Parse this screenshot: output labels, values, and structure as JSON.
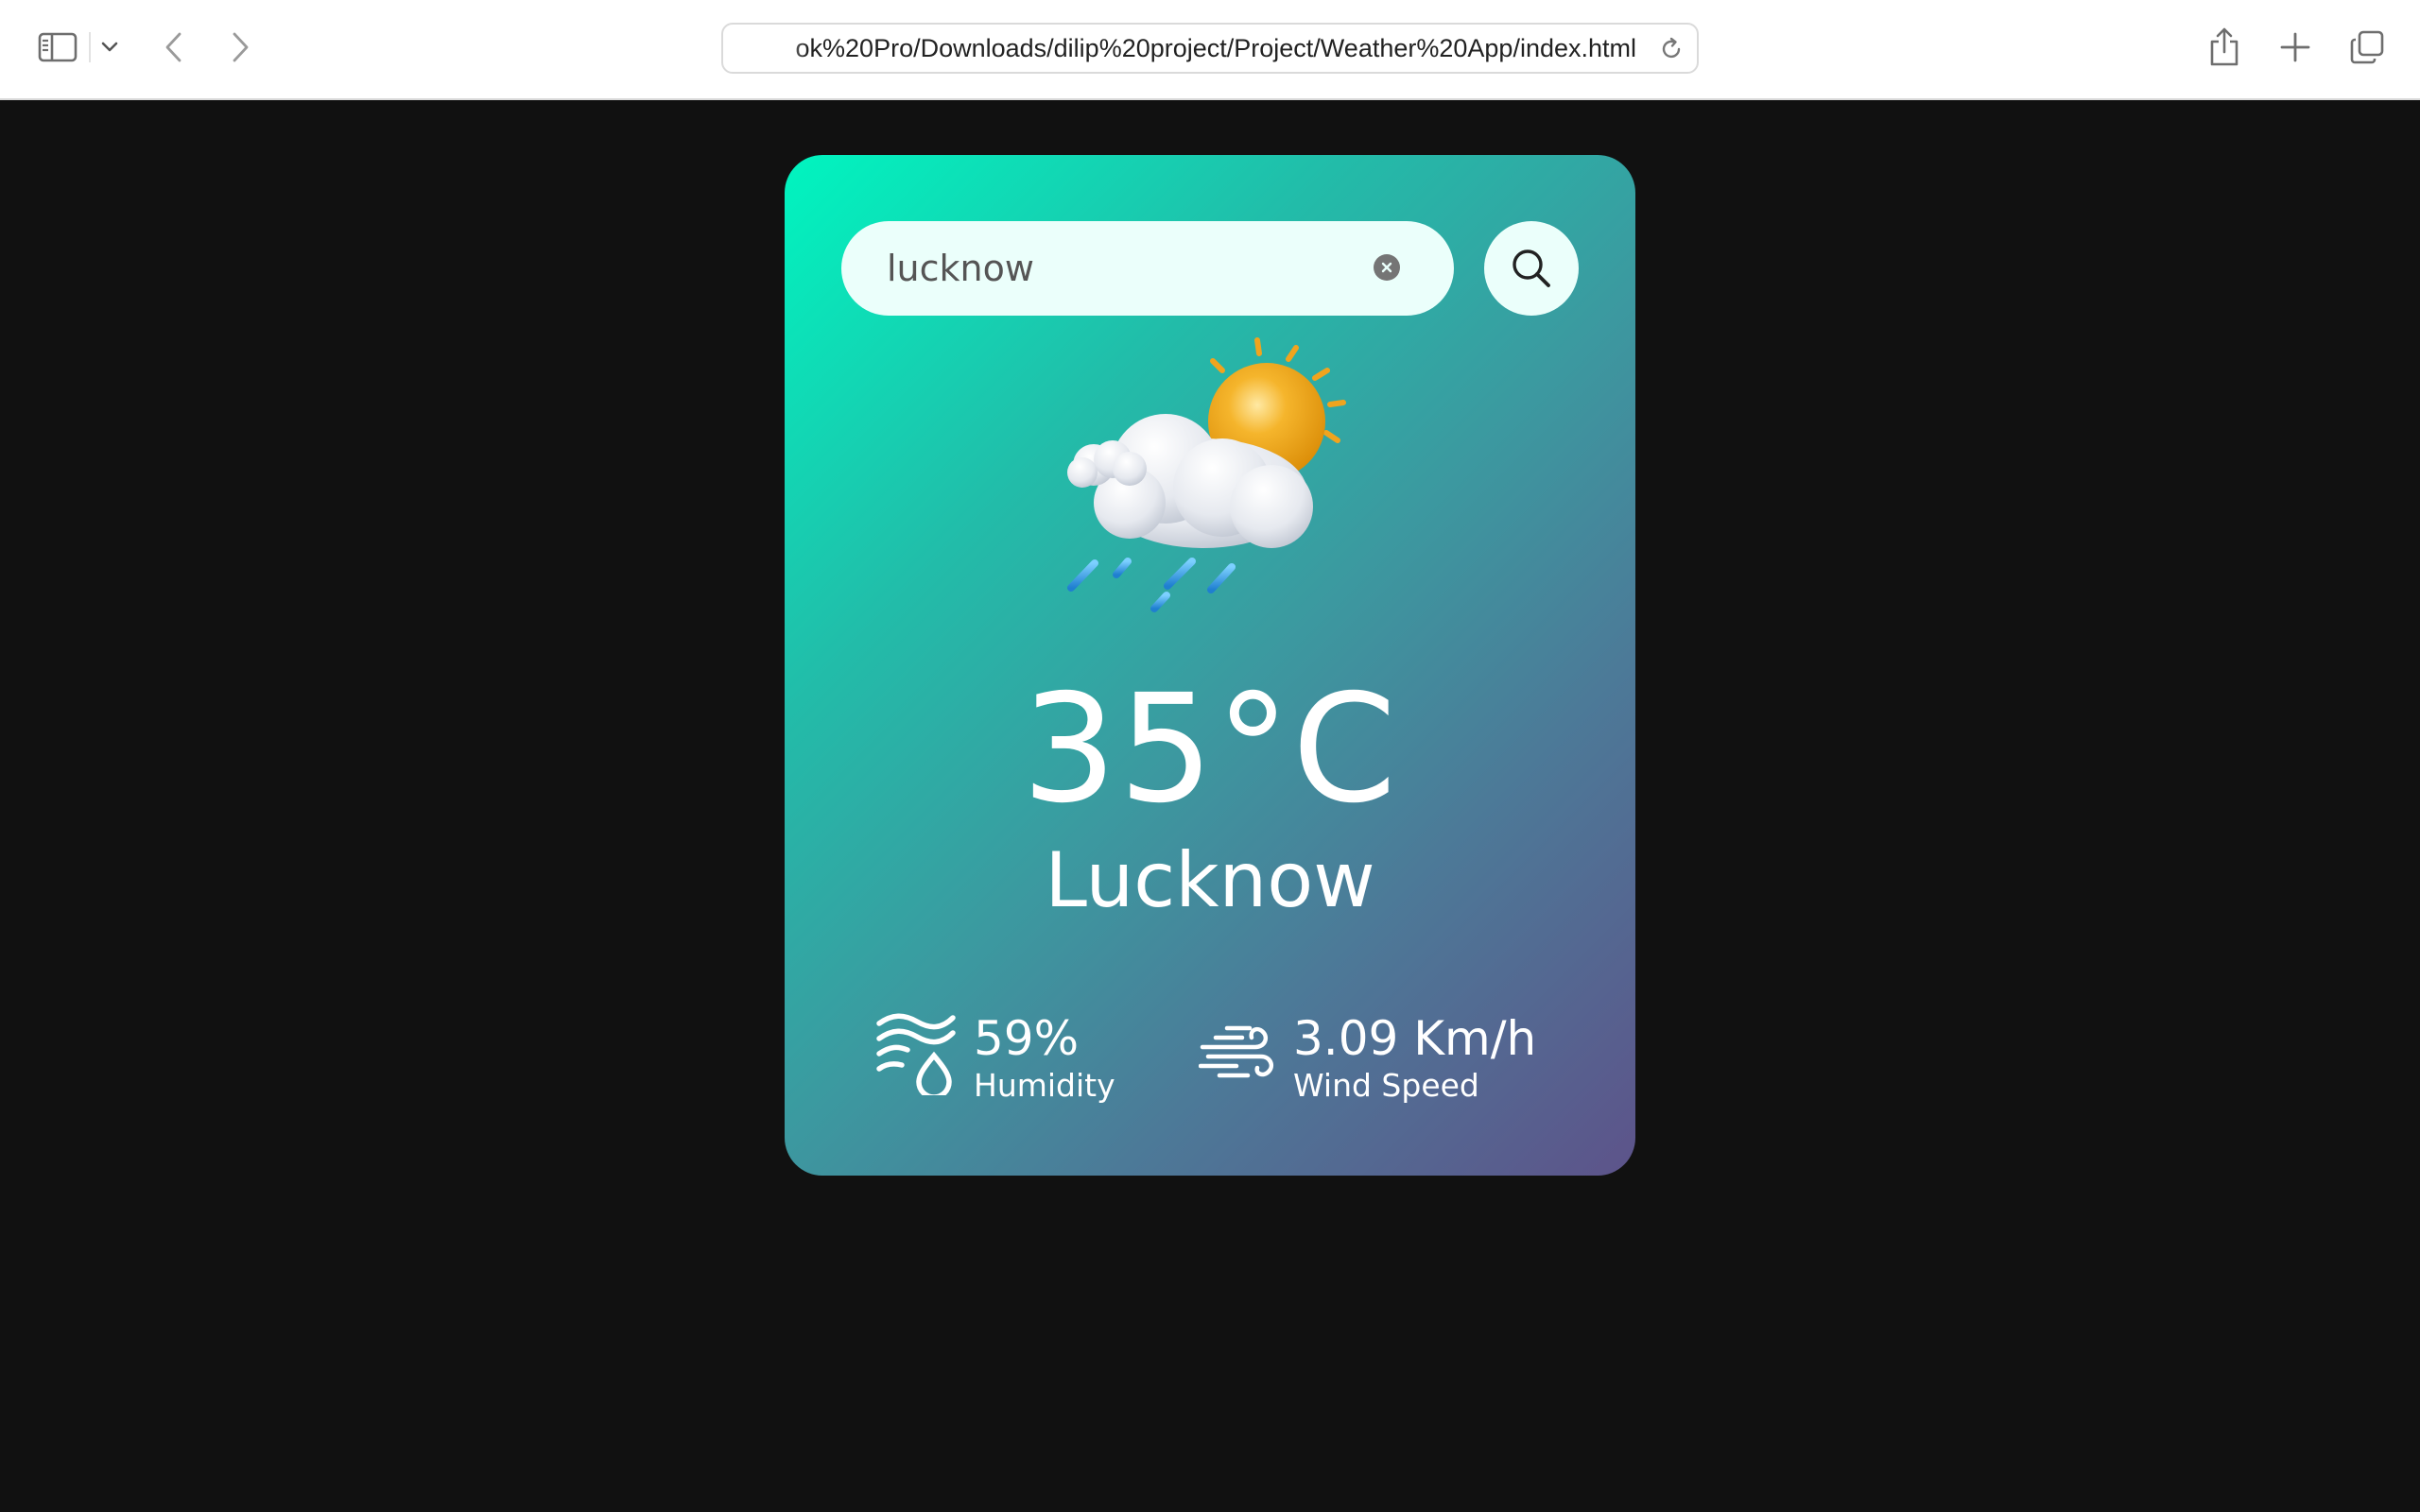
{
  "browser": {
    "url": "ok%20Pro/Downloads/dilip%20project/Project/Weather%20App/index.html",
    "icons": {
      "sidebar": "sidebar-icon",
      "sidebar_menu": "chevron-down-icon",
      "back": "chevron-left-icon",
      "forward": "chevron-right-icon",
      "reload": "reload-icon",
      "share": "share-icon",
      "new_tab": "plus-icon",
      "tab_overview": "tabs-icon"
    }
  },
  "weather": {
    "search": {
      "value": "lucknow",
      "button_icon": "search-icon",
      "clear_icon": "clear-icon"
    },
    "condition_icon": "cloud-sun-rain-icon",
    "temperature": "35°C",
    "city": "Lucknow",
    "humidity": {
      "value": "59%",
      "label": "Humidity",
      "icon": "humidity-icon"
    },
    "wind": {
      "value": "3.09 Km/h",
      "label": "Wind Speed",
      "icon": "wind-icon"
    }
  },
  "colors": {
    "page_background": "#111111",
    "card_gradient_start": "#00f5c0",
    "card_gradient_end": "#5d538a",
    "search_background": "#ebfffb",
    "text": "#ffffff"
  }
}
